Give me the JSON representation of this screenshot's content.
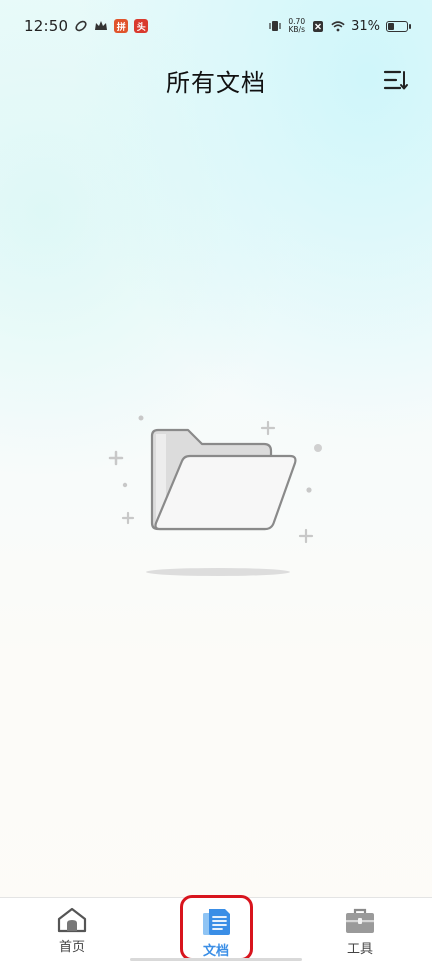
{
  "status_bar": {
    "time": "12:50",
    "net_speed_value": "0.70",
    "net_speed_unit": "KB/s",
    "battery_percent": "31%",
    "battery_level": 0.31
  },
  "header": {
    "title": "所有文档"
  },
  "nav": {
    "items": [
      {
        "label": "首页",
        "icon": "home-icon",
        "active": false
      },
      {
        "label": "文档",
        "icon": "documents-icon",
        "active": true
      },
      {
        "label": "工具",
        "icon": "toolbox-icon",
        "active": false
      }
    ]
  },
  "colors": {
    "accent": "#3a8ee6",
    "highlight": "#d8141d"
  }
}
